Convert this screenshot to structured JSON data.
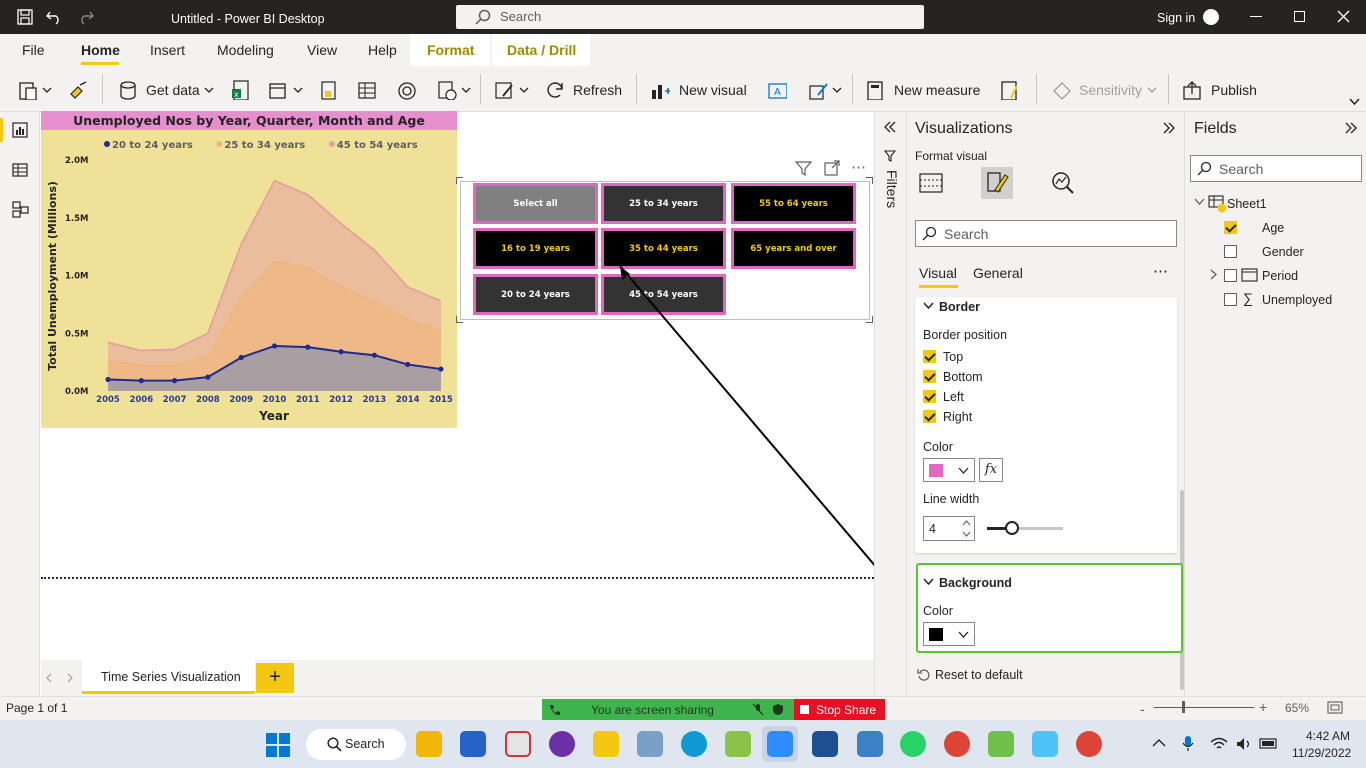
{
  "titlebar": {
    "title": "Untitled - Power BI Desktop",
    "search_placeholder": "Search",
    "sign_in": "Sign in"
  },
  "menu": {
    "file": "File",
    "home": "Home",
    "insert": "Insert",
    "modeling": "Modeling",
    "view": "View",
    "help": "Help",
    "format": "Format",
    "data_drill": "Data / Drill"
  },
  "ribbon": {
    "get_data": "Get data",
    "refresh": "Refresh",
    "new_visual": "New visual",
    "new_measure": "New measure",
    "sensitivity": "Sensitivity",
    "publish": "Publish"
  },
  "chart_data": {
    "type": "area",
    "title": "Unemployed Nos by Year, Quarter, Month and Age",
    "xlabel": "Year",
    "ylabel": "Total Unemployment (Millions)",
    "categories": [
      "2005",
      "2006",
      "2007",
      "2008",
      "2009",
      "2010",
      "2011",
      "2012",
      "2013",
      "2014",
      "2015"
    ],
    "y_ticks": [
      "0.0M",
      "0.5M",
      "1.0M",
      "1.5M",
      "2.0M"
    ],
    "ylim": [
      0,
      2.0
    ],
    "legend_position": "top",
    "series": [
      {
        "name": "20 to 24 years",
        "values": [
          0.1,
          0.09,
          0.09,
          0.12,
          0.29,
          0.39,
          0.38,
          0.34,
          0.31,
          0.23,
          0.19
        ],
        "color": "#1f2a8c"
      },
      {
        "name": "25 to 34 years",
        "values": [
          0.26,
          0.22,
          0.22,
          0.3,
          0.8,
          1.12,
          1.07,
          0.9,
          0.78,
          0.62,
          0.51
        ],
        "color": "#f0b477"
      },
      {
        "name": "45 to 54 years",
        "values": [
          0.42,
          0.35,
          0.36,
          0.5,
          1.27,
          1.82,
          1.7,
          1.45,
          1.22,
          0.9,
          0.78
        ],
        "color": "#e6a0a0"
      }
    ]
  },
  "slicer": {
    "tiles": [
      {
        "label": "Select all",
        "bg": "#808080",
        "fg": "#ffffff"
      },
      {
        "label": "25 to 34 years",
        "bg": "#333333",
        "fg": "#ffffff"
      },
      {
        "label": "55 to 64 years",
        "bg": "#000000",
        "fg": "#f2c811"
      },
      {
        "label": "16 to 19 years",
        "bg": "#000000",
        "fg": "#f2c811"
      },
      {
        "label": "35 to 44 years",
        "bg": "#000000",
        "fg": "#f2c811"
      },
      {
        "label": "65 years and over",
        "bg": "#000000",
        "fg": "#f2c811"
      },
      {
        "label": "20 to 24 years",
        "bg": "#333333",
        "fg": "#ffffff"
      },
      {
        "label": "45 to 54 years",
        "bg": "#333333",
        "fg": "#ffffff"
      }
    ],
    "border_color": "#e068c0"
  },
  "filters": {
    "label": "Filters"
  },
  "viz": {
    "title": "Visualizations",
    "format_visual": "Format visual",
    "search_placeholder": "Search",
    "tab_visual": "Visual",
    "tab_general": "General",
    "border": {
      "header": "Border",
      "position_label": "Border position",
      "positions": [
        "Top",
        "Bottom",
        "Left",
        "Right"
      ],
      "color_label": "Color",
      "color": "#e068c0",
      "line_width_label": "Line width",
      "line_width": "4"
    },
    "background": {
      "header": "Background",
      "color_label": "Color",
      "color": "#000000"
    },
    "reset": "Reset to default"
  },
  "fields": {
    "title": "Fields",
    "search_placeholder": "Search",
    "table": "Sheet1",
    "items": [
      {
        "name": "Age",
        "checked": true
      },
      {
        "name": "Gender",
        "checked": false
      },
      {
        "name": "Period",
        "checked": false
      },
      {
        "name": "Unemployed",
        "checked": false
      }
    ]
  },
  "page_tab": "Time Series Visualization",
  "status": {
    "page": "Page 1 of 1",
    "zoom": "65%",
    "sharing": "You are screen sharing",
    "stop_share": "Stop Share"
  },
  "taskbar": {
    "search": "Search",
    "time": "4:42 AM",
    "date": "11/29/2022"
  }
}
